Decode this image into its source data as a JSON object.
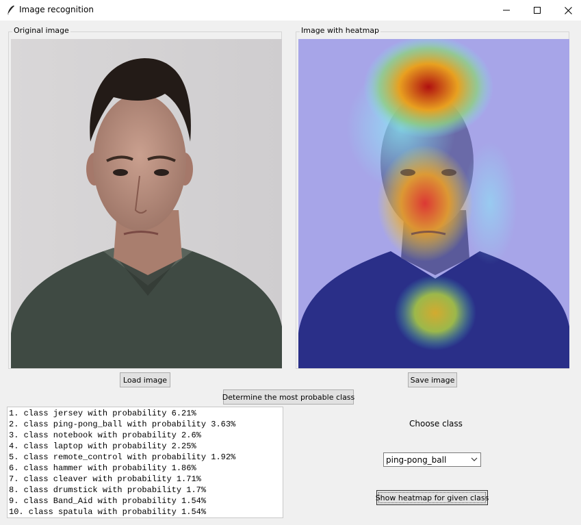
{
  "window": {
    "title": "Image recognition"
  },
  "frames": {
    "original_label": "Original image",
    "heatmap_label": "Image with heatmap"
  },
  "buttons": {
    "load": "Load image",
    "save": "Save image",
    "determine": "Determine the most probable class",
    "show_heatmap": "Show heatmap for given class"
  },
  "results": [
    "1. class jersey with probability 6.21%",
    "2. class ping-pong_ball with probability 3.63%",
    "3. class notebook with probability 2.6%",
    "4. class laptop with probability 2.25%",
    "5. class remote_control with probability 1.92%",
    "6. class hammer with probability 1.86%",
    "7. class cleaver with probability 1.71%",
    "8. class drumstick with probability 1.7%",
    "9. class Band_Aid with probability 1.54%",
    "10. class spatula with probability 1.54%"
  ],
  "class_chooser": {
    "label": "Choose class",
    "selected": "ping-pong_ball"
  },
  "colors": {
    "window_bg": "#f0f0f0",
    "titlebar_bg": "#ffffff",
    "button_bg": "#e1e1e1"
  },
  "icons": [
    "feather-icon",
    "minimize-icon",
    "maximize-icon",
    "close-icon",
    "chevron-down-icon"
  ]
}
